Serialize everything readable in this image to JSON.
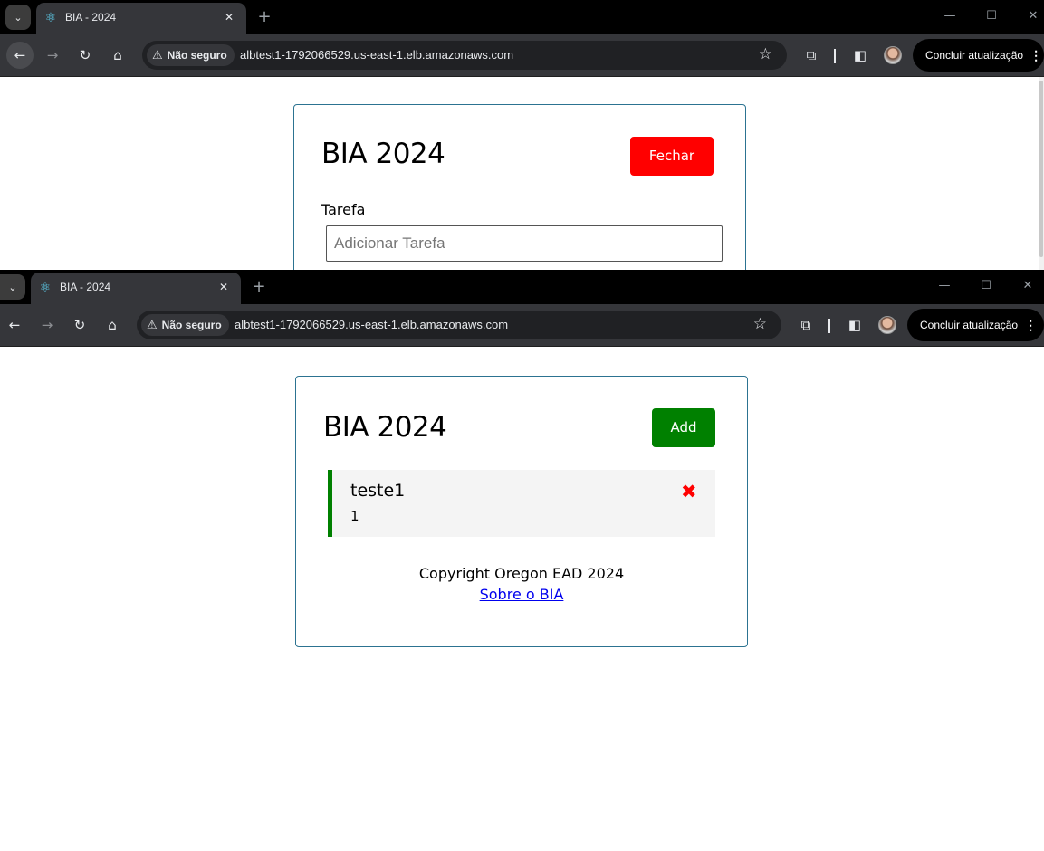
{
  "browser": {
    "tab_title": "BIA - 2024",
    "tab_close": "✕",
    "new_tab": "+",
    "security_label": "Não seguro",
    "url": "albtest1-1792066529.us-east-1.elb.amazonaws.com",
    "update_button": "Concluir atualização",
    "icons": {
      "back": "←",
      "forward": "→",
      "reload": "↻",
      "home": "⌂",
      "bookmark_star": "☆",
      "warning": "⚠",
      "extensions": "⧉",
      "side_panel": "◧",
      "kebab": "⋮",
      "tab_search": "⌄",
      "minimize": "—",
      "maximize": "☐",
      "close": "✕",
      "react_favicon": "⚛"
    },
    "colors": {
      "frame": "#000000",
      "toolbar": "#35363a",
      "omnibox": "#202124"
    }
  },
  "window1": {
    "app_title": "BIA 2024",
    "close_button": "Fechar",
    "task_label": "Tarefa",
    "task_input_placeholder": "Adicionar Tarefa"
  },
  "window2": {
    "app_title": "BIA 2024",
    "add_button": "Add",
    "tasks": [
      {
        "text": "teste1",
        "day": "1",
        "delete_icon": "✖"
      }
    ],
    "footer": {
      "copyright": "Copyright Oregon EAD 2024",
      "about_link": "Sobre o BIA"
    }
  },
  "app_colors": {
    "close_button": "#ff0000",
    "add_button": "#008000",
    "task_border": "#008000",
    "card_border": "#2c7391",
    "delete_icon": "#ff0000"
  }
}
